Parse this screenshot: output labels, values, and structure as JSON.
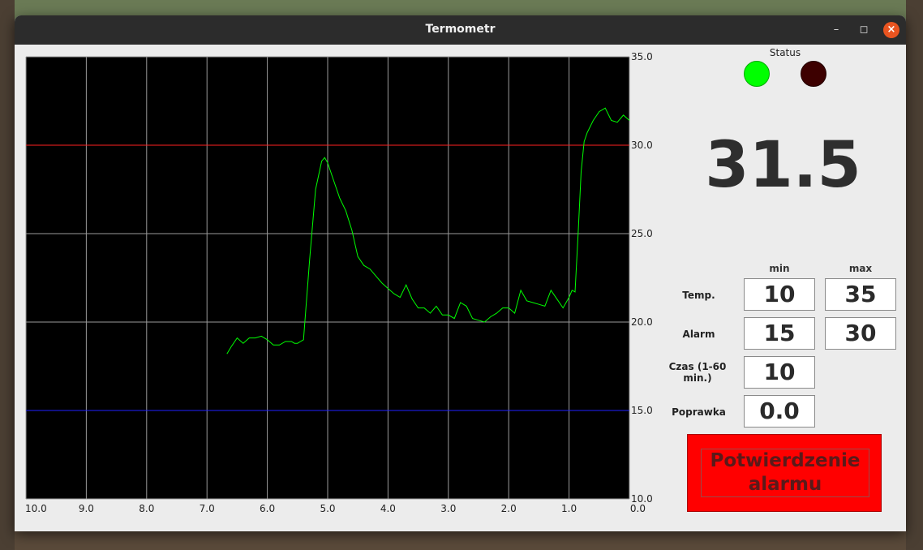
{
  "window": {
    "title": "Termometr"
  },
  "chart_data": {
    "type": "line",
    "xlim": [
      10.0,
      0.0
    ],
    "ylim": [
      10.0,
      35.0
    ],
    "x_ticks": [
      "10.0",
      "9.0",
      "8.0",
      "7.0",
      "6.0",
      "5.0",
      "4.0",
      "3.0",
      "2.0",
      "1.0",
      "0.0"
    ],
    "y_ticks": [
      "35.0",
      "30.0",
      "25.0",
      "20.0",
      "15.0",
      "10.0"
    ],
    "grid": true,
    "background": "#000000",
    "hlines": [
      {
        "value": 30.0,
        "color": "#ff2020"
      },
      {
        "value": 15.0,
        "color": "#2020ff"
      }
    ],
    "series": [
      {
        "color": "#00ff00",
        "x": [
          6.67,
          6.6,
          6.5,
          6.4,
          6.3,
          6.2,
          6.1,
          6.0,
          5.9,
          5.8,
          5.7,
          5.6,
          5.55,
          5.5,
          5.45,
          5.4,
          5.3,
          5.2,
          5.1,
          5.05,
          5.0,
          4.9,
          4.8,
          4.7,
          4.6,
          4.5,
          4.4,
          4.3,
          4.2,
          4.1,
          4.0,
          3.9,
          3.8,
          3.7,
          3.6,
          3.5,
          3.4,
          3.3,
          3.2,
          3.1,
          3.0,
          2.9,
          2.8,
          2.7,
          2.6,
          2.5,
          2.4,
          2.3,
          2.2,
          2.1,
          2.0,
          1.9,
          1.8,
          1.7,
          1.6,
          1.5,
          1.4,
          1.3,
          1.2,
          1.1,
          1.0,
          0.95,
          0.9,
          0.85,
          0.8,
          0.75,
          0.7,
          0.6,
          0.5,
          0.4,
          0.3,
          0.2,
          0.1,
          0.0
        ],
        "y": [
          18.2,
          18.6,
          19.1,
          18.8,
          19.1,
          19.1,
          19.2,
          19.0,
          18.7,
          18.7,
          18.9,
          18.9,
          18.8,
          18.8,
          18.9,
          19.0,
          23.5,
          27.5,
          29.1,
          29.3,
          29.0,
          28.0,
          27.0,
          26.3,
          25.2,
          23.7,
          23.2,
          23.0,
          22.6,
          22.2,
          21.9,
          21.6,
          21.4,
          22.1,
          21.3,
          20.8,
          20.8,
          20.5,
          20.9,
          20.4,
          20.4,
          20.2,
          21.1,
          20.9,
          20.2,
          20.1,
          20.0,
          20.3,
          20.5,
          20.8,
          20.8,
          20.5,
          21.8,
          21.2,
          21.1,
          21.0,
          20.9,
          21.8,
          21.3,
          20.8,
          21.4,
          21.8,
          21.7,
          25.0,
          28.5,
          30.2,
          30.7,
          31.4,
          31.9,
          32.1,
          31.4,
          31.3,
          31.7,
          31.4
        ]
      }
    ]
  },
  "status": {
    "label": "Status",
    "ok_color": "#00ff00",
    "alarm_color": "#3d0000"
  },
  "current_temp": "31.5",
  "settings": {
    "col_min": "min",
    "col_max": "max",
    "temp_label": "Temp.",
    "temp_min": "10",
    "temp_max": "35",
    "alarm_label": "Alarm",
    "alarm_min": "15",
    "alarm_max": "30",
    "time_label": "Czas (1-60 min.)",
    "time_value": "10",
    "offset_label": "Poprawka",
    "offset_value": "0.0"
  },
  "ack_button": {
    "label": "Potwierdzenie alarmu"
  }
}
